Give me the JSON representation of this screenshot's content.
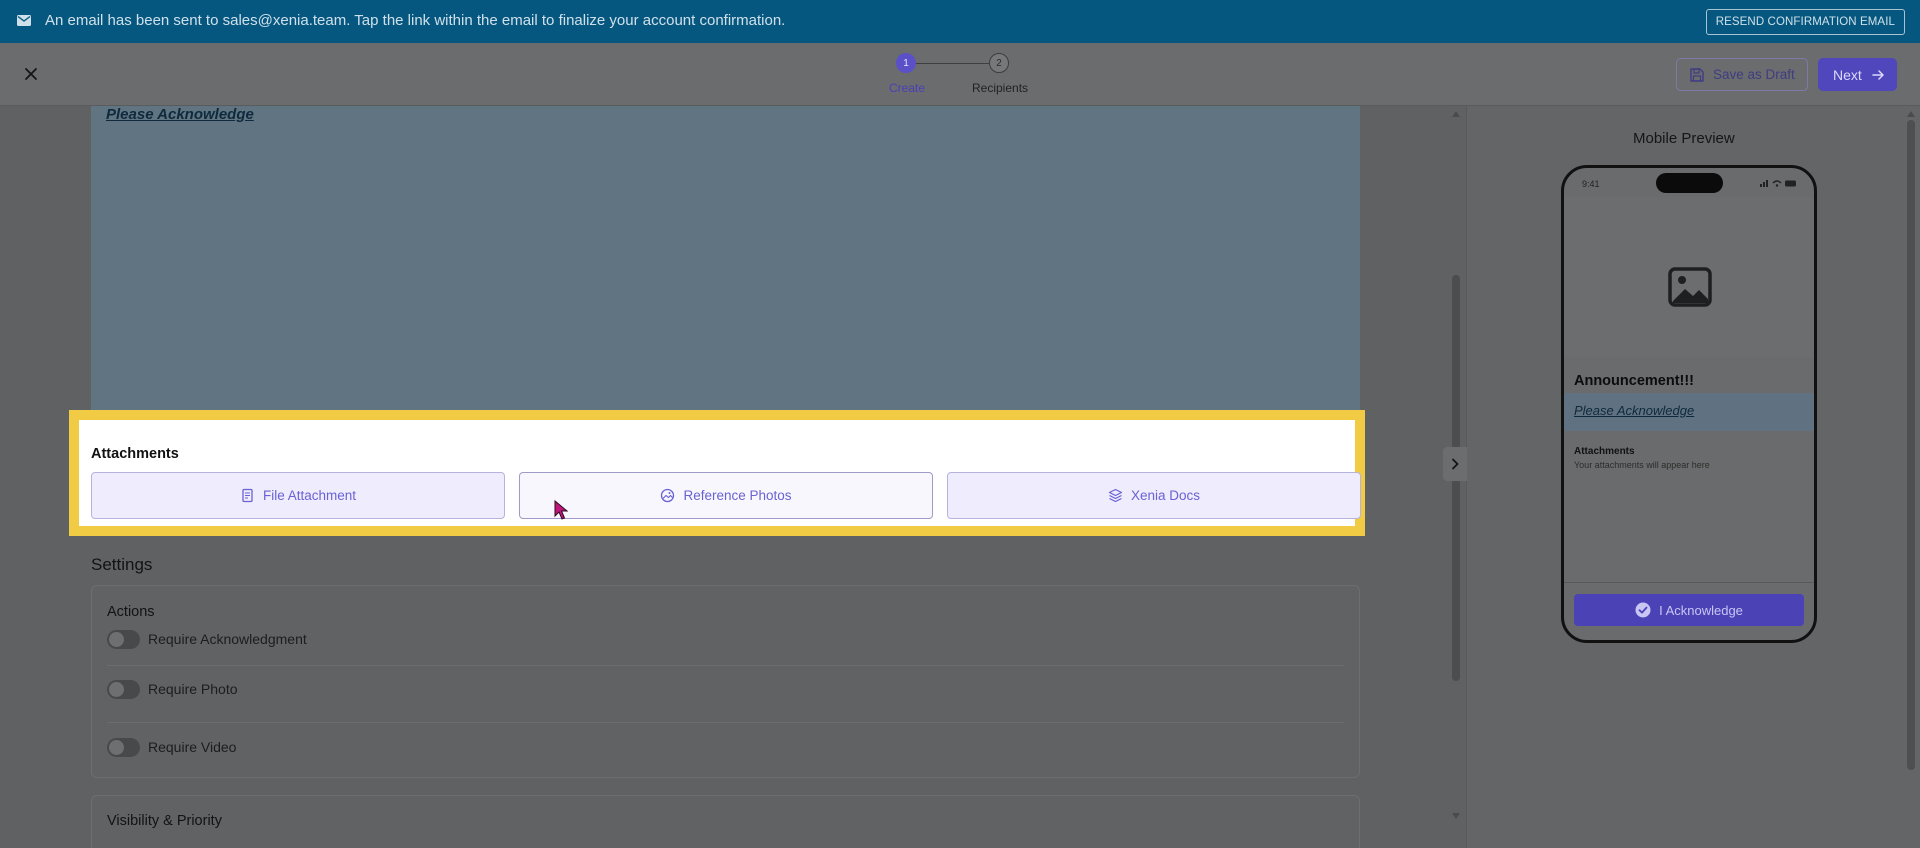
{
  "banner": {
    "message": "An email has been sent to sales@xenia.team. Tap the link within the email to finalize your account confirmation.",
    "resend_label": "RESEND CONFIRMATION EMAIL"
  },
  "header": {
    "steps": [
      {
        "number": "1",
        "label": "Create",
        "active": true
      },
      {
        "number": "2",
        "label": "Recipients",
        "active": false
      }
    ],
    "save_draft_label": "Save as Draft",
    "next_label": "Next"
  },
  "editor": {
    "body_text": "Please Acknowledge"
  },
  "attachments": {
    "title": "Attachments",
    "buttons": [
      {
        "label": "File Attachment",
        "icon": "file-icon"
      },
      {
        "label": "Reference Photos",
        "icon": "photo-icon"
      },
      {
        "label": "Xenia Docs",
        "icon": "layers-icon"
      }
    ]
  },
  "settings": {
    "title": "Settings",
    "actions_title": "Actions",
    "toggles": [
      {
        "label": "Require Acknowledgment",
        "on": false
      },
      {
        "label": "Require Photo",
        "on": false
      },
      {
        "label": "Require Video",
        "on": false
      }
    ],
    "visibility_title": "Visibility & Priority"
  },
  "preview": {
    "title": "Mobile Preview",
    "time": "9:41",
    "announcement_title": "Announcement!!!",
    "acknowledge_text": "Please Acknowledge",
    "attachments_title": "Attachments",
    "attachments_placeholder": "Your attachments will appear here",
    "ack_button_label": "I Acknowledge"
  },
  "colors": {
    "banner": "#06577f",
    "primary": "#5047bd",
    "highlight": "#f2cb45"
  }
}
